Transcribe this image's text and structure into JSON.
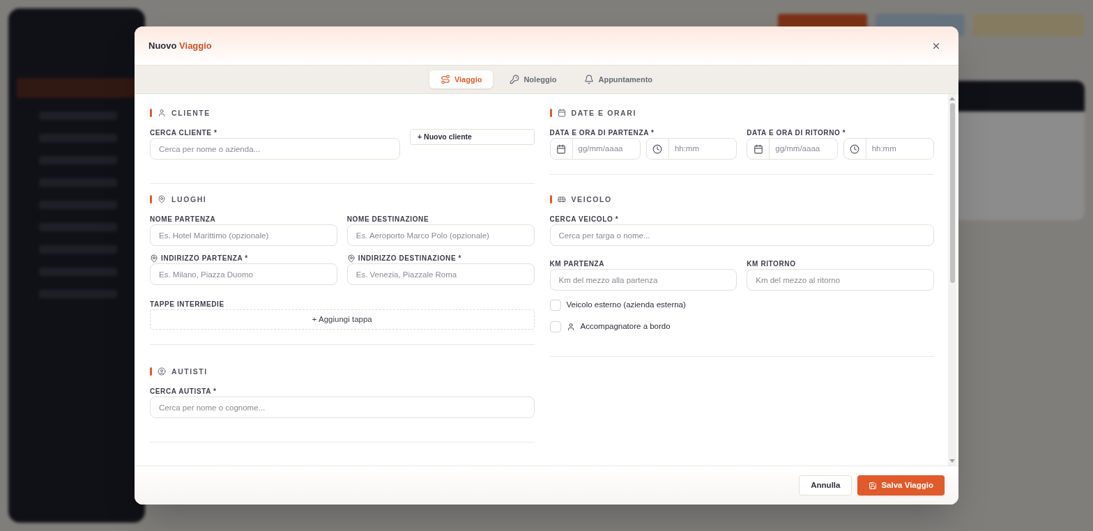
{
  "dialog": {
    "title": "Nuovo",
    "title_accent": "Viaggio"
  },
  "tabs": [
    {
      "label": "Viaggio",
      "selected": true
    },
    {
      "label": "Noleggio",
      "selected": false
    },
    {
      "label": "Appuntamento",
      "selected": false
    }
  ],
  "cliente": {
    "heading": "CLIENTE",
    "label": "CERCA CLIENTE *",
    "placeholder": "Cerca per nome o azienda...",
    "new_button": "+ Nuovo cliente"
  },
  "luoghi": {
    "heading": "LUOGHI",
    "fields": [
      {
        "label": "NOME PARTENZA",
        "placeholder": "Es. Hotel Marittimo (opzionale)",
        "pin": false
      },
      {
        "label": "NOME DESTINAZIONE",
        "placeholder": "Es. Aeroporto Marco Polo (opzionale)",
        "pin": false
      },
      {
        "label": "INDIRIZZO PARTENZA *",
        "placeholder": "Es. Milano, Piazza Duomo",
        "pin": true
      },
      {
        "label": "INDIRIZZO DESTINAZIONE *",
        "placeholder": "Es. Venezia, Piazzale Roma",
        "pin": true
      }
    ],
    "stops_label": "TAPPE INTERMEDIE",
    "add_stop": "+ Aggiungi tappa"
  },
  "autisti": {
    "heading": "AUTISTI",
    "label": "CERCA AUTISTA *",
    "placeholder": "Cerca per nome o cognome..."
  },
  "date_orari": {
    "heading": "DATE E ORARI",
    "groups": [
      {
        "label": "DATA E ORA DI PARTENZA *",
        "date_placeholder": "gg/mm/aaaa",
        "time_placeholder": "hh:mm"
      },
      {
        "label": "DATA E ORA DI RITORNO *",
        "date_placeholder": "gg/mm/aaaa",
        "time_placeholder": "hh:mm"
      }
    ]
  },
  "veicolo": {
    "heading": "VEICOLO",
    "label": "CERCA VEICOLO *",
    "placeholder": "Cerca per targa o nome...",
    "km": [
      {
        "label": "KM PARTENZA",
        "placeholder": "Km del mezzo alla partenza"
      },
      {
        "label": "KM RITORNO",
        "placeholder": "Km del mezzo al ritorno"
      }
    ],
    "options": [
      {
        "label": "Veicolo esterno (azienda esterna)",
        "checked": false,
        "person_icon": false
      },
      {
        "label": "Accompagnatore a bordo",
        "checked": false,
        "person_icon": true
      }
    ]
  },
  "footer": {
    "cancel": "Annulla",
    "save": "Salva Viaggio"
  }
}
